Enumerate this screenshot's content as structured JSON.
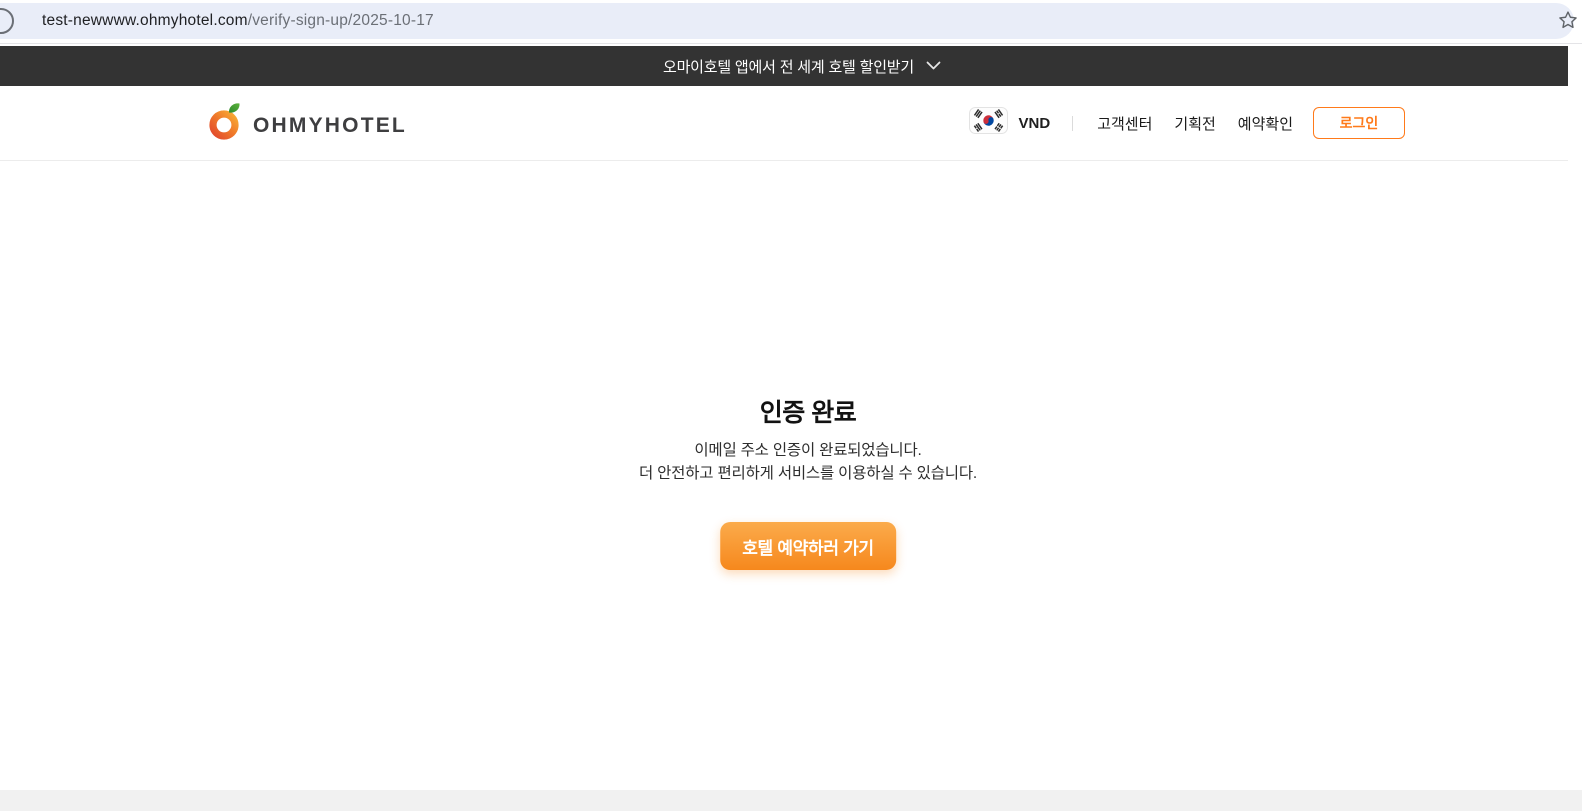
{
  "browser": {
    "url_domain": "test-newwww.ohmyhotel.com",
    "url_path": "/verify-sign-up/2025-10-17"
  },
  "promo_banner": {
    "text": "오마이호텔 앱에서 전 세계 호텔 할인받기"
  },
  "header": {
    "logo_text": "OHMYHOTEL",
    "currency": "VND",
    "nav": [
      {
        "label": "고객센터"
      },
      {
        "label": "기획전"
      },
      {
        "label": "예약확인"
      }
    ],
    "login_label": "로그인"
  },
  "main": {
    "title": "인증 완료",
    "description_line1": "이메일 주소 인증이 완료되었습니다.",
    "description_line2": "더 안전하고 편리하게 서비스를 이용하실 수 있습니다.",
    "cta_label": "호텔 예약하러 가기"
  },
  "colors": {
    "accent_orange": "#FF7A1A",
    "banner_bg": "#333333",
    "cta_gradient_top": "#FBAB4B",
    "cta_gradient_bottom": "#F6881D",
    "footer_bg": "#F1F1F1",
    "omnibox_bg": "#E9EDF8",
    "flag_red": "#CD2E3A",
    "flag_blue": "#0047A0",
    "logo_green": "#3E9C35"
  },
  "icons": {
    "site_info": "site-info-icon",
    "bookmark": "bookmark-star-icon",
    "banner_chevron": "chevron-down-icon",
    "currency_flag": "korea-flag-icon",
    "logo_mark": "orange-ring-leaf-icon"
  }
}
